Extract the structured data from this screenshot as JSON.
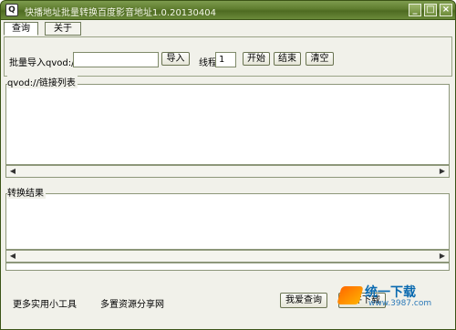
{
  "window": {
    "title": "快播地址批量转换百度影音地址1.0.20130404",
    "min_label": "_",
    "max_label": "□",
    "close_label": "×",
    "icon_glyph": "Q"
  },
  "tabs": [
    {
      "label": "查询"
    },
    {
      "label": "关于"
    }
  ],
  "toolbar": {
    "import_label": "批量导入qvod://",
    "import_value": "",
    "import_button": "导入",
    "threads_label": "线程",
    "threads_value": "1",
    "start_button": "开始",
    "end_button": "结束",
    "clear_button": "清空"
  },
  "link_list": {
    "label": "qvod://链接列表"
  },
  "results": {
    "label": "转换结果"
  },
  "footer": {
    "tools_link": "更多实用小工具",
    "share_link": "多置资源分享网",
    "love_query_button": "我爱查询",
    "exit_button": "软件下载"
  },
  "watermark": {
    "main": "统一下载",
    "sub": "www.3987.com"
  },
  "scroll": {
    "left_arrow": "◀",
    "right_arrow": "▶"
  }
}
